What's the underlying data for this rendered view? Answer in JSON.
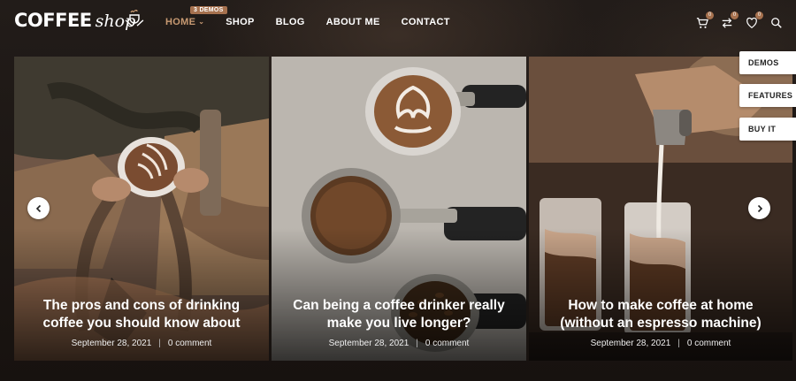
{
  "brand": {
    "word": "COFFEE",
    "script": "shop"
  },
  "nav": {
    "items": [
      {
        "label": "HOME",
        "active": true,
        "badge": "3 DEMOS"
      },
      {
        "label": "SHOP"
      },
      {
        "label": "BLOG"
      },
      {
        "label": "ABOUT ME"
      },
      {
        "label": "CONTACT"
      }
    ]
  },
  "header_icons": {
    "cart_count": "0",
    "compare_count": "0",
    "wishlist_count": "0",
    "icons": [
      "cart-icon",
      "compare-icon",
      "heart-icon",
      "search-icon"
    ]
  },
  "slider": {
    "posts": [
      {
        "title": "The pros and cons of drinking coffee you should know about",
        "date": "September 28, 2021",
        "comments": "0 comment"
      },
      {
        "title": "Can being a coffee drinker really make you live longer?",
        "date": "September 28, 2021",
        "comments": "0 comment"
      },
      {
        "title": "How to make coffee at home (without an espresso machine)",
        "date": "September 28, 2021",
        "comments": "0 comment"
      }
    ],
    "prev_icon": "chevron-left-icon",
    "next_icon": "chevron-right-icon"
  },
  "side_panel": {
    "demos": "DEMOS",
    "features": "FEATURES",
    "buy": "BUY IT"
  },
  "colors": {
    "accent": "#a6714e",
    "active_nav": "#c89a72",
    "background": "#1b1614"
  }
}
